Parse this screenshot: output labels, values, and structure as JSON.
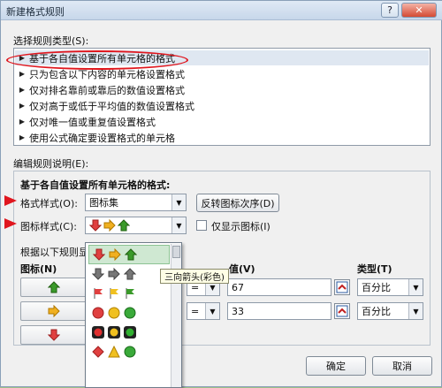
{
  "dialog": {
    "title": "新建格式规则",
    "help_label": "?",
    "close_label": "✕"
  },
  "rule_types": {
    "label": "选择规则类型(S):",
    "items": [
      "基于各自值设置所有单元格的格式",
      "只为包含以下内容的单元格设置格式",
      "仅对排名靠前或靠后的数值设置格式",
      "仅对高于或低于平均值的数值设置格式",
      "仅对唯一值或重复值设置格式",
      "使用公式确定要设置格式的单元格"
    ],
    "selected_index": 0
  },
  "rule_desc": {
    "label": "编辑规则说明(E):",
    "heading": "基于各自值设置所有单元格的格式:",
    "format_style_label": "格式样式(O):",
    "format_style_value": "图标集",
    "reverse_button": "反转图标次序(D)",
    "icon_style_label": "图标样式(C):",
    "show_icon_only": "仅显示图标(I)",
    "rule_intro": "根据以下规则显",
    "col_icon": "图标(N)",
    "col_value": "值(V)",
    "col_type": "类型(T)",
    "rows": [
      {
        "op": "=",
        "value": "67",
        "type": "百分比"
      },
      {
        "op": "=",
        "value": "33",
        "type": "百分比"
      }
    ]
  },
  "icon_popup": {
    "tooltip": "三向箭头(彩色)"
  },
  "footer": {
    "ok": "确定",
    "cancel": "取消"
  },
  "colors": {
    "accent_red": "#e0161e",
    "arrow_green": "#3a9a2a",
    "arrow_yellow": "#f0b020",
    "arrow_red": "#e04040"
  }
}
